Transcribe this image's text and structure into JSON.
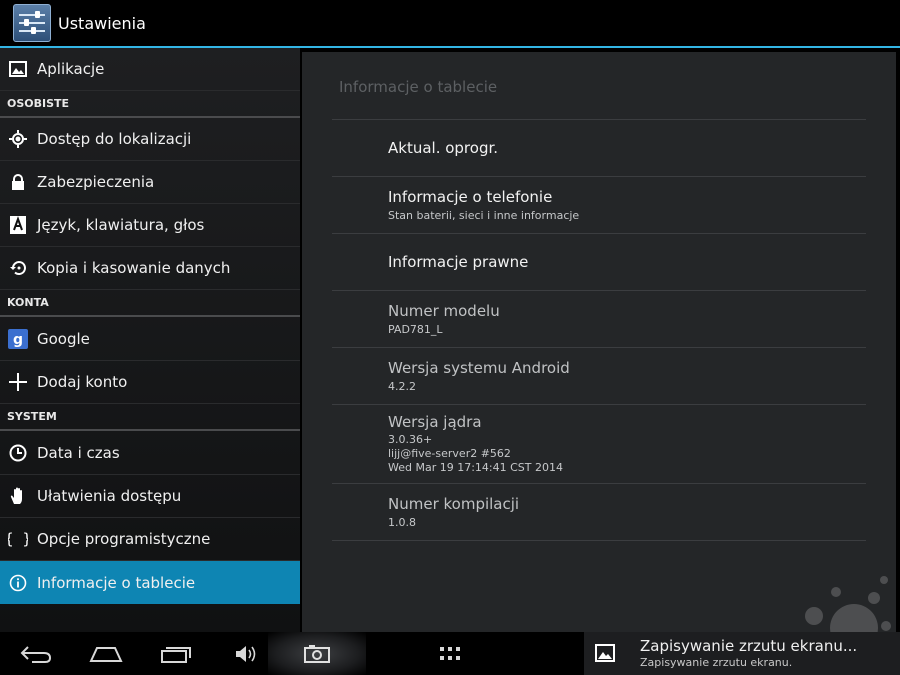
{
  "app": {
    "title": "Ustawienia"
  },
  "sidebar": {
    "top_item": {
      "label": "Aplikacje",
      "icon": "image-icon"
    },
    "sections": [
      {
        "header": "OSOBISTE",
        "items": [
          {
            "label": "Dostęp do lokalizacji",
            "icon": "location-icon"
          },
          {
            "label": "Zabezpieczenia",
            "icon": "lock-icon"
          },
          {
            "label": "Język, klawiatura, głos",
            "icon": "language-icon"
          },
          {
            "label": "Kopia i kasowanie danych",
            "icon": "backup-icon"
          }
        ]
      },
      {
        "header": "KONTA",
        "items": [
          {
            "label": "Google",
            "icon": "google-icon"
          },
          {
            "label": "Dodaj konto",
            "icon": "plus-icon"
          }
        ]
      },
      {
        "header": "SYSTEM",
        "items": [
          {
            "label": "Data i czas",
            "icon": "clock-icon"
          },
          {
            "label": "Ułatwienia dostępu",
            "icon": "hand-icon"
          },
          {
            "label": "Opcje programistyczne",
            "icon": "braces-icon"
          },
          {
            "label": "Informacje o tablecie",
            "icon": "info-icon",
            "selected": true
          }
        ]
      }
    ]
  },
  "detail": {
    "title": "Informacje o tablecie",
    "rows": [
      {
        "title": "Aktual. oprogr."
      },
      {
        "title": "Informacje o telefonie",
        "subtitle": "Stan baterii, sieci i inne informacje"
      },
      {
        "title": "Informacje prawne"
      },
      {
        "title": "Numer modelu",
        "value": "PAD781_L"
      },
      {
        "title": "Wersja systemu Android",
        "value": "4.2.2"
      },
      {
        "title": "Wersja jądra",
        "value_lines": [
          "3.0.36+",
          "lijj@five-server2 #562",
          "Wed Mar 19 17:14:41 CST 2014"
        ]
      },
      {
        "title": "Numer kompilacji",
        "value": "1.0.8"
      }
    ]
  },
  "navbar": {
    "buttons": [
      "back-icon",
      "home-icon",
      "recent-apps-icon",
      "volume-icon",
      "screenshot-icon",
      "app-drawer-icon"
    ]
  },
  "notification": {
    "title": "Zapisywanie zrzutu ekranu...",
    "text": "Zapisywanie zrzutu ekranu."
  },
  "colors": {
    "accent": "#33b5e5",
    "selected": "#0e85b3"
  }
}
